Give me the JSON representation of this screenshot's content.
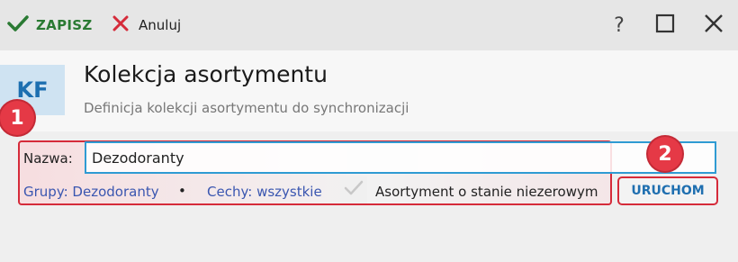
{
  "toolbar": {
    "save_label": "ZAPISZ",
    "cancel_label": "Anuluj",
    "help_label": "?"
  },
  "header": {
    "logo_text": "KF",
    "title": "Kolekcja asortymentu",
    "subtitle": "Definicja kolekcji asortymentu do synchronizacji"
  },
  "form": {
    "name_label": "Nazwa:",
    "name_value": "Dezodoranty",
    "groups_link": "Grupy: Dezodoranty",
    "separator": "•",
    "features_link": "Cechy: wszystkie",
    "checkbox_label": "Asortyment o stanie niezerowym",
    "checkbox_checked": true,
    "run_button": "URUCHOM"
  },
  "annotations": {
    "badge_1": "1",
    "badge_2": "2"
  },
  "colors": {
    "save_green": "#2a7a33",
    "cancel_red": "#d52b3a",
    "accent_blue": "#1f6fb0",
    "badge_red": "#e53946",
    "input_border": "#2f9bd3"
  },
  "icons": {
    "save": "checkmark-icon",
    "cancel": "x-icon",
    "maximize": "maximize-icon",
    "close": "close-icon",
    "checkbox": "checkbox-check-icon"
  }
}
